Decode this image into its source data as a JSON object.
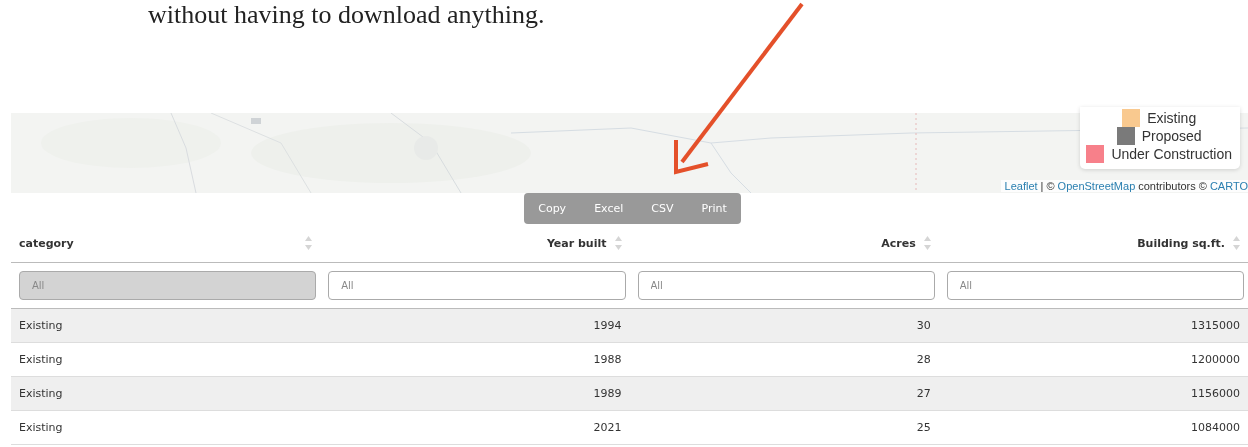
{
  "intro_text": "without having to download anything.",
  "map": {
    "legend": [
      {
        "label": "Existing",
        "color": "#f9c98f"
      },
      {
        "label": "Proposed",
        "color": "#7a7a7a"
      },
      {
        "label": "Under Construction",
        "color": "#f7808a"
      }
    ],
    "attribution": [
      {
        "kind": "link",
        "text": "Leaflet"
      },
      {
        "kind": "plain",
        "text": "| ©"
      },
      {
        "kind": "link",
        "text": "OpenStreetMap"
      },
      {
        "kind": "plain",
        "text": "contributors ©"
      },
      {
        "kind": "link",
        "text": "CARTO"
      }
    ]
  },
  "export_buttons": [
    "Copy",
    "Excel",
    "CSV",
    "Print"
  ],
  "table": {
    "columns": [
      {
        "label": "category",
        "kind": "text"
      },
      {
        "label": "Year built",
        "kind": "number"
      },
      {
        "label": "Acres",
        "kind": "number"
      },
      {
        "label": "Building sq.ft.",
        "kind": "number"
      }
    ],
    "filters": [
      {
        "kind": "select",
        "placeholder": "All"
      },
      {
        "kind": "text",
        "placeholder": "All"
      },
      {
        "kind": "text",
        "placeholder": "All"
      },
      {
        "kind": "text",
        "placeholder": "All"
      }
    ],
    "rows": [
      [
        "Existing",
        "1994",
        "30",
        "1315000"
      ],
      [
        "Existing",
        "1988",
        "28",
        "1200000"
      ],
      [
        "Existing",
        "1989",
        "27",
        "1156000"
      ],
      [
        "Existing",
        "2021",
        "25",
        "1084000"
      ]
    ]
  }
}
